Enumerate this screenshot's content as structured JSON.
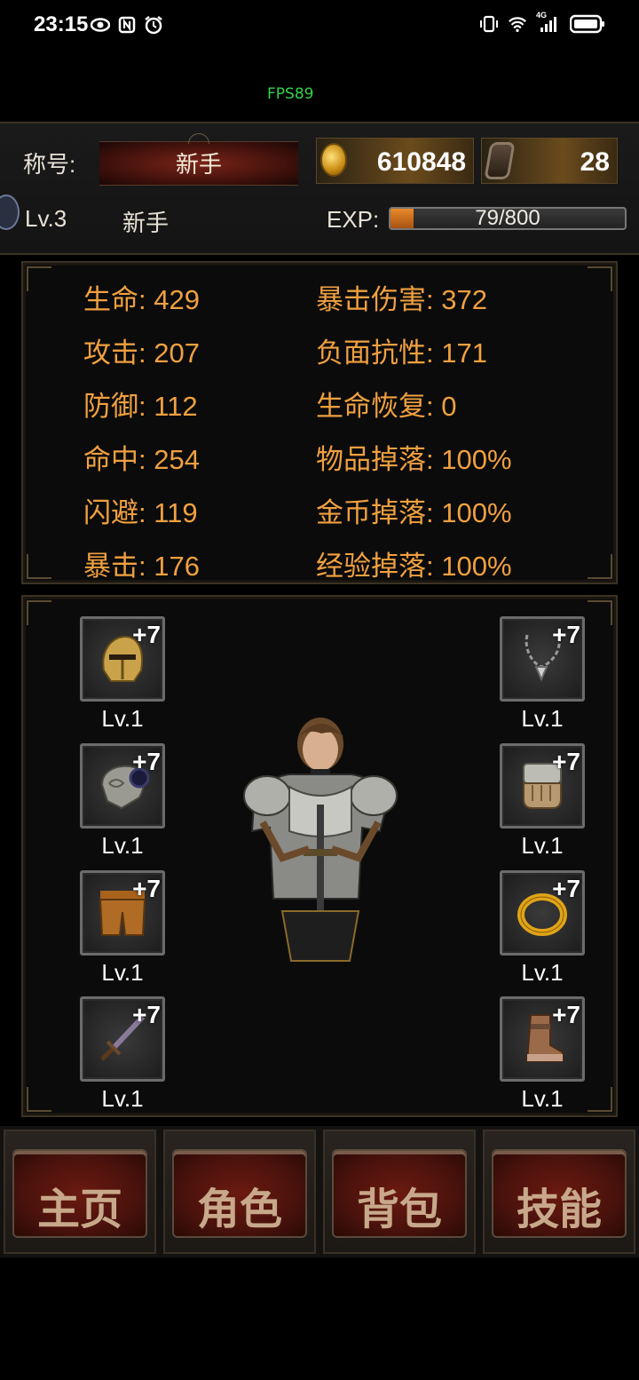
{
  "status_bar": {
    "time": "23:15",
    "network": "4G"
  },
  "fps": "FPS89",
  "header": {
    "title_label": "称号:",
    "title_value": "新手",
    "gold": "610848",
    "gems": "28",
    "level": "Lv.3",
    "rank": "新手",
    "exp_label": "EXP:",
    "exp_text": "79/800",
    "exp_fraction": 0.099
  },
  "stats": {
    "left": [
      "生命: 429",
      "攻击: 207",
      "防御: 112",
      "命中: 254",
      "闪避: 119",
      "暴击: 176"
    ],
    "right": [
      "暴击伤害: 372",
      "负面抗性: 171",
      "生命恢复: 0",
      "物品掉落: 100%",
      "金币掉落: 100%",
      "经验掉落: 100%"
    ]
  },
  "equipment": {
    "left": [
      {
        "icon": "helmet-icon",
        "plus": "+7",
        "level": "Lv.1"
      },
      {
        "icon": "shoulder-armor-icon",
        "plus": "+7",
        "level": "Lv.1"
      },
      {
        "icon": "pants-icon",
        "plus": "+7",
        "level": "Lv.1"
      },
      {
        "icon": "sword-icon",
        "plus": "+7",
        "level": "Lv.1"
      }
    ],
    "right": [
      {
        "icon": "necklace-icon",
        "plus": "+7",
        "level": "Lv.1"
      },
      {
        "icon": "gauntlet-icon",
        "plus": "+7",
        "level": "Lv.1"
      },
      {
        "icon": "ring-icon",
        "plus": "+7",
        "level": "Lv.1"
      },
      {
        "icon": "boots-icon",
        "plus": "+7",
        "level": "Lv.1"
      }
    ]
  },
  "nav": [
    "主页",
    "角色",
    "背包",
    "技能"
  ],
  "colors": {
    "stat_text": "#f0a040",
    "fps": "#2fd34a",
    "exp_fill": "#e88a2a"
  }
}
